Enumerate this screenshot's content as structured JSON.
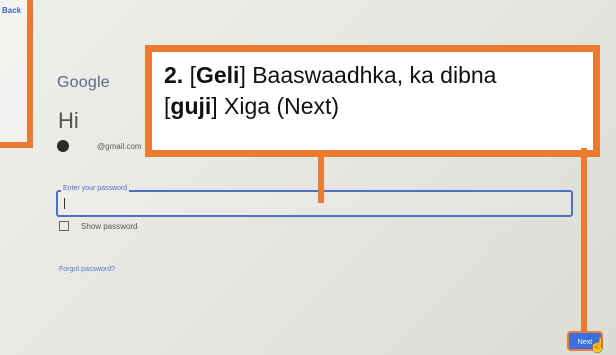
{
  "nav": {
    "back_label": "Back"
  },
  "login": {
    "brand": "Google",
    "greeting": "Hi",
    "email": "@gmail.com",
    "password_label": "Enter your password",
    "show_password_label": "Show password",
    "forgot_password_label": "Forgot password?",
    "next_label": "Next"
  },
  "callout": {
    "step": "2.",
    "bracket_open_1": "[",
    "word_1": "Geli",
    "text_1": "] Baaswaadhka, ka dibna",
    "bracket_open_2": "[",
    "word_2": "guji",
    "text_2": "] Xiga (Next)"
  },
  "colors": {
    "callout_border": "#ec7a2f",
    "link_blue": "#3f66c9",
    "button_blue": "#3b6fe0"
  }
}
